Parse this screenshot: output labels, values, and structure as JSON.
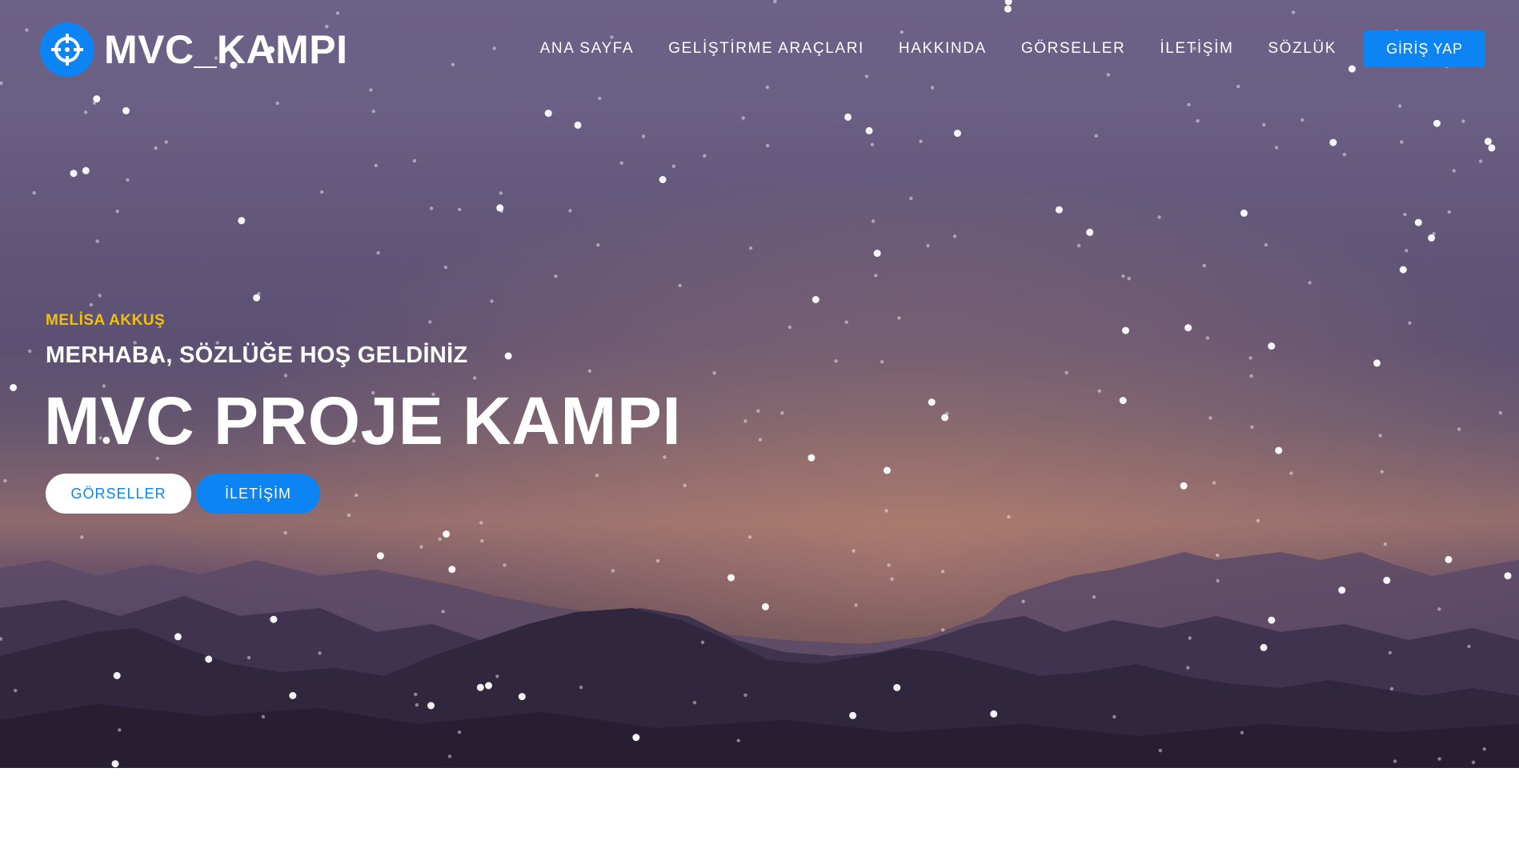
{
  "header": {
    "brand": "MVC_KAMPI",
    "logo_icon": "crosshair-icon",
    "nav": [
      {
        "label": "ANA SAYFA"
      },
      {
        "label": "GELİŞTİRME ARAÇLARI"
      },
      {
        "label": "HAKKINDA"
      },
      {
        "label": "GÖRSELLER"
      },
      {
        "label": "İLETİŞİM"
      },
      {
        "label": "SÖZLÜK"
      }
    ],
    "login": "GİRİŞ YAP"
  },
  "hero": {
    "author": "MELİSA AKKUŞ",
    "greeting": "MERHABA, SÖZLÜĞE HOŞ GELDİNİZ",
    "title": "MVC PROJE KAMPI",
    "buttons": {
      "primary": "GÖRSELLER",
      "secondary": "İLETİŞİM"
    }
  },
  "colors": {
    "accent": "#0c84f3",
    "author": "#f3c00e",
    "text": "#ffffff"
  }
}
